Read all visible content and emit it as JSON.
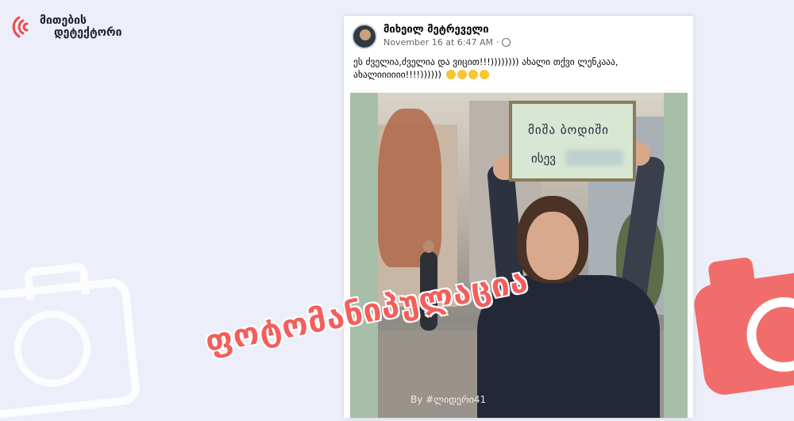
{
  "logo": {
    "line1": "მითების",
    "line2": "დეტექტორი"
  },
  "post": {
    "author": "მიხეილ მეტრეველი",
    "timestamp": "November 16 at 6:47 AM",
    "privacy_icon": "globe-icon",
    "text_line1": "ეს ძველია,ძველია და ვიცით!!!)))))))) ახალი თქვი ლენკააა,",
    "text_line2": "ახალიიიიიი!!!!))))))",
    "emoji_count": 4
  },
  "photo": {
    "sign_line1": "მიშა ბოდიში",
    "sign_line2": "ისევ",
    "watermark": "By #ლიდერი41"
  },
  "stamp": {
    "text": "ფოტომანიპულაცია",
    "color": "#f25f5c"
  },
  "colors": {
    "background": "#eceef9",
    "accent": "#ef4a4a",
    "camera_right": "#f16d6b"
  }
}
